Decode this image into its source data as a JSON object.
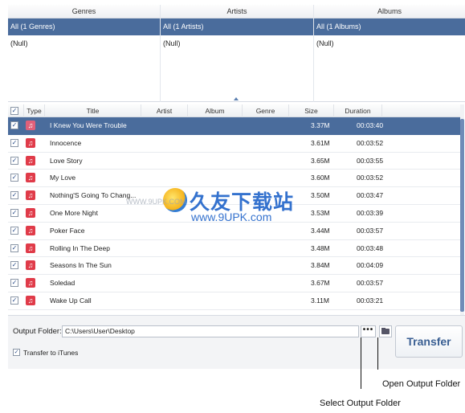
{
  "browser": {
    "columns": [
      {
        "header": "Genres",
        "selected": "All (1 Genres)",
        "null_item": "(Null)"
      },
      {
        "header": "Artists",
        "selected": "All (1 Artists)",
        "null_item": "(Null)"
      },
      {
        "header": "Albums",
        "selected": "All (1 Albums)",
        "null_item": "(Null)"
      }
    ]
  },
  "table": {
    "headers": {
      "type": "Type",
      "title": "Title",
      "artist": "Artist",
      "album": "Album",
      "genre": "Genre",
      "size": "Size",
      "duration": "Duration"
    },
    "rows": [
      {
        "title": "I Knew You Were Trouble",
        "size": "3.37M",
        "duration": "00:03:40",
        "selected": true
      },
      {
        "title": "Innocence",
        "size": "3.61M",
        "duration": "00:03:52"
      },
      {
        "title": "Love Story",
        "size": "3.65M",
        "duration": "00:03:55"
      },
      {
        "title": "My Love",
        "size": "3.60M",
        "duration": "00:03:52"
      },
      {
        "title": "Nothing'S Going To Chang...",
        "size": "3.50M",
        "duration": "00:03:47"
      },
      {
        "title": "One More Night",
        "size": "3.53M",
        "duration": "00:03:39"
      },
      {
        "title": "Poker Face",
        "size": "3.44M",
        "duration": "00:03:57"
      },
      {
        "title": "Rolling In The Deep",
        "size": "3.48M",
        "duration": "00:03:48"
      },
      {
        "title": "Seasons In The Sun",
        "size": "3.84M",
        "duration": "00:04:09"
      },
      {
        "title": "Soledad",
        "size": "3.67M",
        "duration": "00:03:57"
      },
      {
        "title": "Wake Up Call",
        "size": "3.11M",
        "duration": "00:03:21"
      }
    ],
    "check_glyph": "✓",
    "music_glyph": "♫",
    "colors": {
      "selection": "#4a6c9c",
      "music_icon": "#e03b49"
    }
  },
  "bottom": {
    "output_label": "Output Folder:",
    "output_value": "C:\\Users\\User\\Desktop",
    "browse_label": "•••",
    "transfer_label": "Transfer",
    "itunes_label": "Transfer to iTunes"
  },
  "callouts": {
    "open_folder": "Open Output Folder",
    "select_folder": "Select Output Folder"
  },
  "watermark": {
    "title": "久友下载站",
    "url": "www.9UPK.com",
    "url_small": "WWW.9UPK.COM"
  }
}
